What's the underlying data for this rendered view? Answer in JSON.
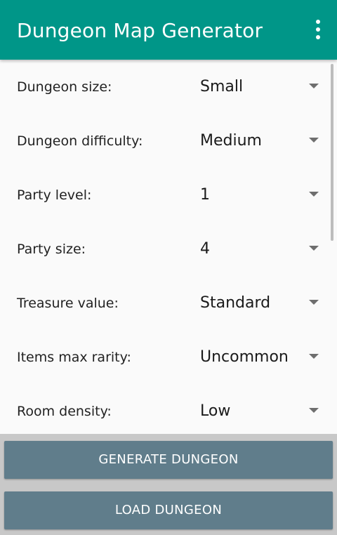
{
  "appbar": {
    "title": "Dungeon Map Generator",
    "background": "#009688",
    "menu_icon": "overflow-menu-icon"
  },
  "settings": [
    {
      "label": "Dungeon size:",
      "value": "Small"
    },
    {
      "label": "Dungeon difficulty:",
      "value": "Medium"
    },
    {
      "label": "Party level:",
      "value": "1"
    },
    {
      "label": "Party size:",
      "value": "4"
    },
    {
      "label": "Treasure value:",
      "value": "Standard"
    },
    {
      "label": "Items max rarity:",
      "value": "Uncommon"
    },
    {
      "label": "Room density:",
      "value": "Low"
    }
  ],
  "actions": {
    "generate_label": "GENERATE DUNGEON",
    "load_label": "LOAD DUNGEON",
    "button_color": "#607d8b"
  }
}
